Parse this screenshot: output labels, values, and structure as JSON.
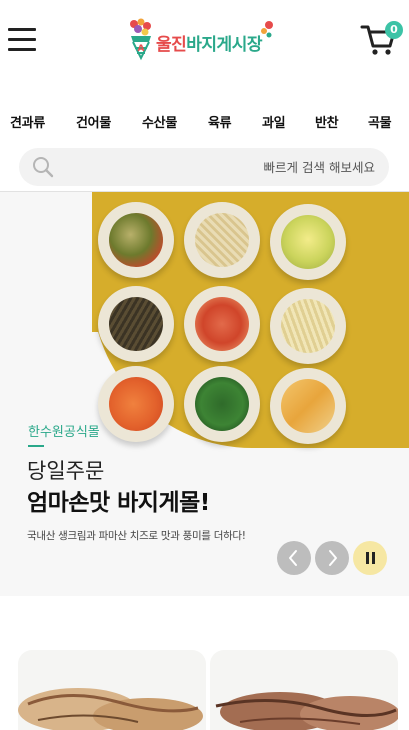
{
  "header": {
    "logo_text_part1": "울진",
    "logo_text_part2": "바지게시장",
    "cart_count": "0",
    "icons": [
      "hamburger-menu-icon",
      "logo-icon",
      "cart-icon"
    ]
  },
  "categories": [
    "견과류",
    "건어물",
    "수산물",
    "육류",
    "과일",
    "반찬",
    "곡물"
  ],
  "search": {
    "placeholder": "빠르게 검색 해보세요"
  },
  "banner": {
    "brand": "한수원공식몰",
    "subtitle": "당일주문",
    "title": "엄마손맛 바지게몰!",
    "description": "국내산 생크림과 파마산 치즈로 맛과 풍미를 더하다!",
    "controls": [
      "prev-icon",
      "next-icon",
      "pause-icon"
    ]
  },
  "colors": {
    "accent_green": "#2aa88a",
    "logo_red": "#e64b4b",
    "banner_mustard": "#d6ad2b",
    "cart_badge": "#3cc3a6",
    "pause_bg": "#f6e7a3"
  }
}
